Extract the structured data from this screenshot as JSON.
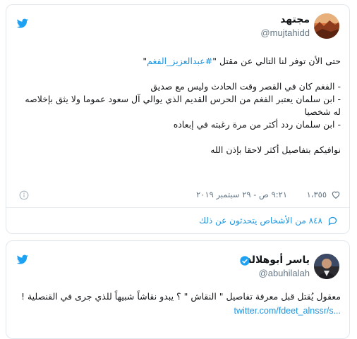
{
  "tweet1": {
    "name": "مجتهد",
    "handle": "@mujtahidd",
    "lines": [
      {
        "type": "intro",
        "pre": "حتى الأن توفر لنا التالي عن مقتل \"",
        "hashtag": "#عبدالعزيز_الفغم",
        "post": "\""
      },
      {
        "type": "gap"
      },
      {
        "type": "text",
        "text": "- الفغم كان في القصر وقت الحادث وليس مع صديق"
      },
      {
        "type": "text",
        "text": "- ابن سلمان يعتبر الفغم من الحرس القديم الذي يوالي آل سعود عموما ولا يثق بإخلاصه له شخصيا"
      },
      {
        "type": "text",
        "text": "- ابن سلمان ردد أكثر من مرة رغبته في إبعاده"
      },
      {
        "type": "gap"
      },
      {
        "type": "text",
        "text": "نوافيكم بتفاصيل أكثر لاحقا بإذن الله"
      }
    ],
    "likes": "١،٣٥٥",
    "timestamp": "٩:٢١ ص - ٢٩ سبتمبر ٢٠١٩",
    "replies_text": "٨٤٨ من الأشخاص يتحدثون عن ذلك"
  },
  "tweet2": {
    "name": "ياسر أبوهلالة",
    "handle": "@abuhilalah",
    "text": "معقول يُقتل قبل معرفة تفاصيل \" النقاش \" ؟ يبدو نقاشاً شبيهاً للذي جرى في القنصلية !",
    "link": "twitter.com/fdeet_alnssr/s..."
  },
  "colors": {
    "accent": "#1da1f2",
    "link": "#1b95e0",
    "muted": "#657786",
    "verified": "#1da1f2"
  },
  "icons": [
    "twitter-bird-icon",
    "heart-icon",
    "info-icon",
    "reply-bubble-icon",
    "verified-badge-icon"
  ]
}
